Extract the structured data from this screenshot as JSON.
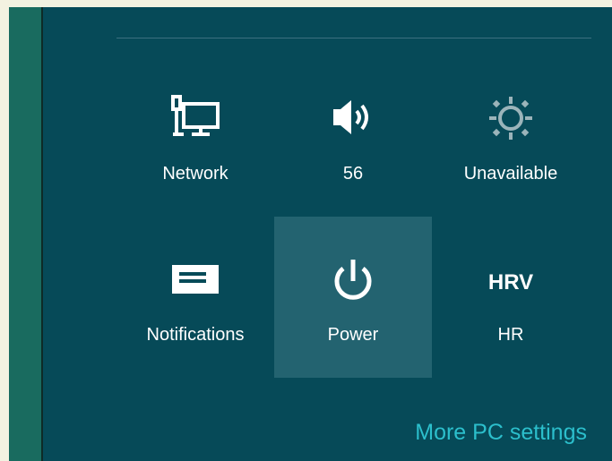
{
  "settings": {
    "tiles": [
      {
        "label": "Network",
        "icon": "network-icon"
      },
      {
        "label": "56",
        "icon": "volume-icon"
      },
      {
        "label": "Unavailable",
        "icon": "brightness-icon"
      },
      {
        "label": "Notifications",
        "icon": "notifications-icon"
      },
      {
        "label": "Power",
        "icon": "power-icon"
      },
      {
        "label": "HR",
        "icon_text": "HRV"
      }
    ],
    "more_link": "More PC settings"
  },
  "colors": {
    "panel": "#064a58",
    "active_tile": "#236370",
    "link": "#2cbfcc",
    "left_strip": "#196b5f"
  }
}
